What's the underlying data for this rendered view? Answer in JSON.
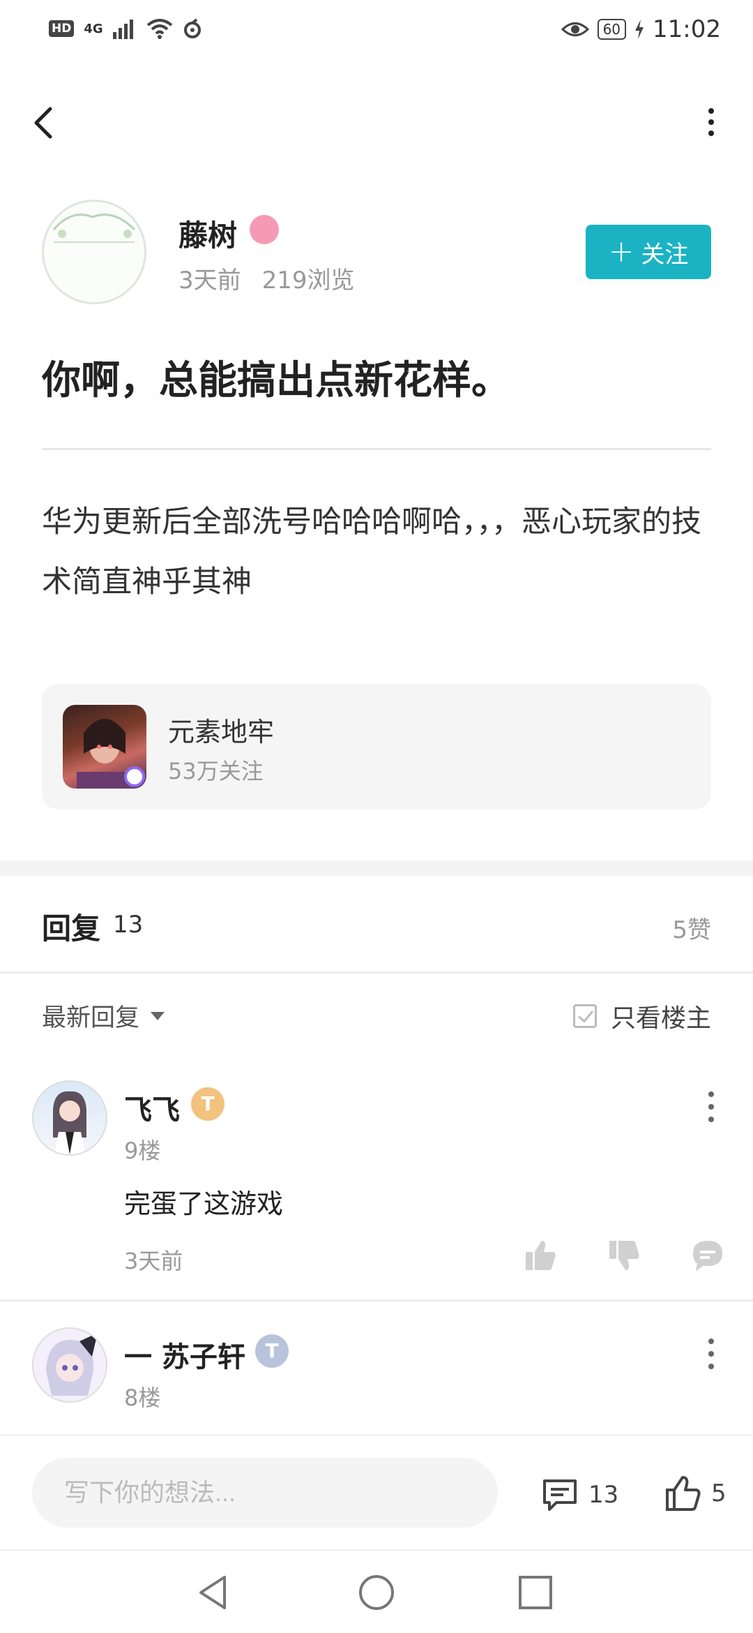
{
  "status_bar": {
    "hd": "HD",
    "network": "4G",
    "battery": "60",
    "time": "11:02"
  },
  "author": {
    "name": "藤树",
    "posted": "3天前",
    "views": "219浏览"
  },
  "follow_label": "关注",
  "post": {
    "title": "你啊，总能搞出点新花样。",
    "body": "华为更新后全部洗号哈哈哈啊哈，，，恶心玩家的技术简直神乎其神"
  },
  "game": {
    "name": "元素地牢",
    "fans": "53万关注"
  },
  "replies": {
    "title": "回复",
    "count": "13",
    "likes": "5赞",
    "sort": "最新回复",
    "only_op": "只看楼主"
  },
  "comments": [
    {
      "name": "飞飞",
      "badge": "T",
      "floor": "9楼",
      "text": "完蛋了这游戏",
      "time": "3天前"
    },
    {
      "name": "一 苏子轩",
      "badge": "T",
      "floor": "8楼"
    }
  ],
  "bottom_bar": {
    "placeholder": "写下你的想法...",
    "comment_count": "13",
    "like_count": "5"
  }
}
